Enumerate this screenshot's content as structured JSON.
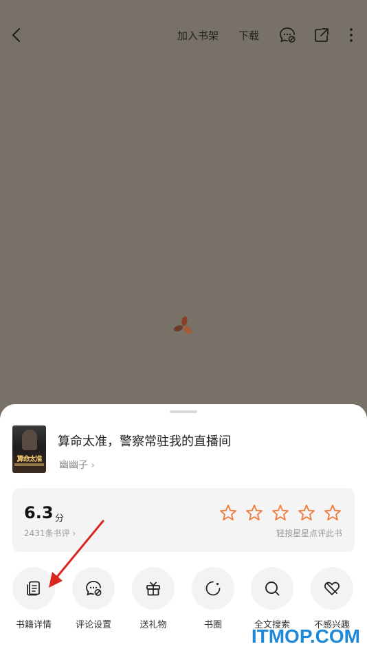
{
  "topbar": {
    "add_to_shelf": "加入书架",
    "download": "下载"
  },
  "book": {
    "title": "算命太准，警察常驻我的直播间",
    "author": "幽幽子",
    "cover_title": "算命太准"
  },
  "rating": {
    "score": "6.3",
    "unit": "分",
    "review_count": "2431条书评",
    "stars_total": 5,
    "star_hint": "轻按星星点评此书"
  },
  "actions": [
    {
      "label": "书籍详情",
      "icon": "book-detail-icon"
    },
    {
      "label": "评论设置",
      "icon": "comment-settings-icon"
    },
    {
      "label": "送礼物",
      "icon": "gift-icon"
    },
    {
      "label": "书圈",
      "icon": "book-circle-icon"
    },
    {
      "label": "全文搜索",
      "icon": "search-icon"
    },
    {
      "label": "不感兴趣",
      "icon": "not-interested-icon"
    }
  ],
  "colors": {
    "overlay": "#777168",
    "star": "#f07a3a",
    "annotation_arrow": "#d8261f",
    "watermark": "#1e88d8"
  },
  "watermark": "ITMOP.COM"
}
